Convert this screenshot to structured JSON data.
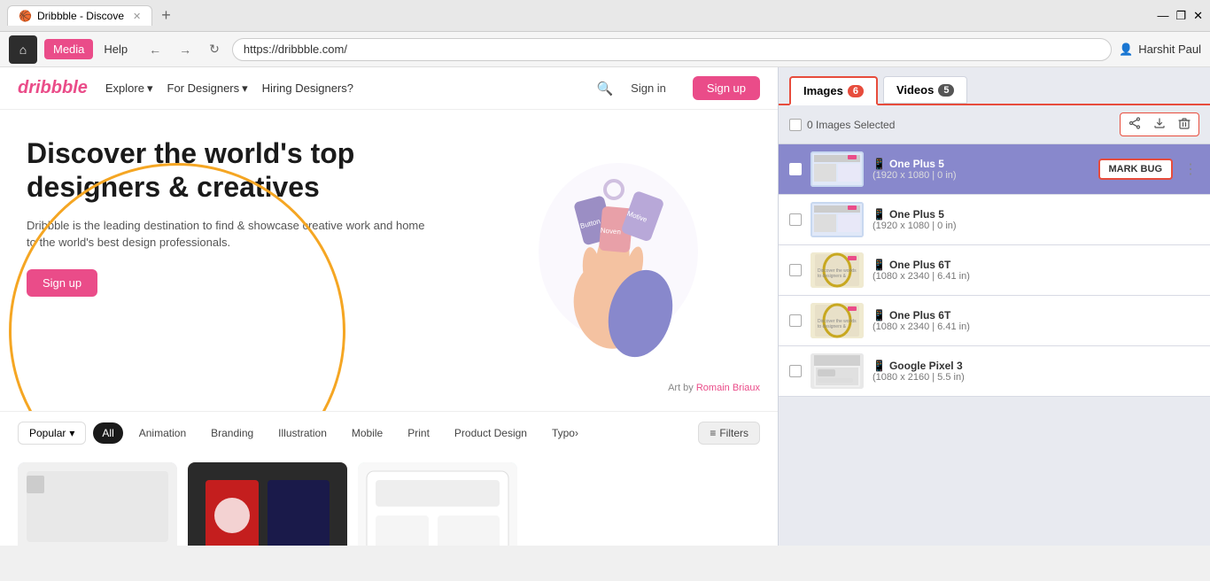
{
  "browser": {
    "tab_title": "Dribbble - Discove",
    "tab_favicon": "🏀",
    "new_tab_btn": "+",
    "nav_back": "←",
    "nav_forward": "→",
    "nav_reload": "↻",
    "address": "https://dribbble.com/",
    "home_icon": "🏠",
    "nav_tabs": [
      {
        "label": "Media",
        "active": true
      },
      {
        "label": "Help",
        "active": false
      }
    ],
    "profile_icon": "👤",
    "profile_name": "Harshit Paul",
    "window_min": "—",
    "window_max": "❐",
    "window_close": "✕"
  },
  "dribbble": {
    "logo": "dribbble",
    "nav": [
      {
        "label": "Explore",
        "has_arrow": true
      },
      {
        "label": "For Designers",
        "has_arrow": true
      },
      {
        "label": "Hiring Designers?",
        "has_arrow": false
      }
    ],
    "search_icon": "🔍",
    "sign_in": "Sign in",
    "sign_up": "Sign up",
    "hero": {
      "title": "Discover the world's top designers & creatives",
      "description": "Dribbble is the leading destination to find & showcase creative work and home to the world's best design professionals.",
      "cta": "Sign up",
      "art_credit": "Art by",
      "artist": "Romain Briaux"
    },
    "filter_bar": {
      "popular_label": "Popular",
      "filters": [
        {
          "label": "All",
          "active": true
        },
        {
          "label": "Animation",
          "active": false
        },
        {
          "label": "Branding",
          "active": false
        },
        {
          "label": "Illustration",
          "active": false
        },
        {
          "label": "Mobile",
          "active": false
        },
        {
          "label": "Print",
          "active": false
        },
        {
          "label": "Product Design",
          "active": false
        },
        {
          "label": "Typo›",
          "active": false
        }
      ],
      "filters_btn": "Filters"
    }
  },
  "panel": {
    "tabs": [
      {
        "label": "Images",
        "count": "6",
        "active": true
      },
      {
        "label": "Videos",
        "count": "5",
        "active": false
      }
    ],
    "toolbar": {
      "selected_count": "0 Images Selected",
      "share_icon": "share",
      "download_icon": "download",
      "delete_icon": "delete"
    },
    "images": [
      {
        "id": 1,
        "name": "One Plus 5",
        "dims": "(1920 x 1080 | 0 in)",
        "selected": true,
        "show_mark_bug": true
      },
      {
        "id": 2,
        "name": "One Plus 5",
        "dims": "(1920 x 1080 | 0 in)",
        "selected": false,
        "show_mark_bug": false
      },
      {
        "id": 3,
        "name": "One Plus 6T",
        "dims": "(1080 x 2340 | 6.41 in)",
        "selected": false,
        "show_mark_bug": false
      },
      {
        "id": 4,
        "name": "One Plus 6T",
        "dims": "(1080 x 2340 | 6.41 in)",
        "selected": false,
        "show_mark_bug": false
      },
      {
        "id": 5,
        "name": "Google Pixel 3",
        "dims": "(1080 x 2160 | 5.5 in)",
        "selected": false,
        "show_mark_bug": false
      }
    ],
    "mark_bug_label": "MARK BUG"
  }
}
